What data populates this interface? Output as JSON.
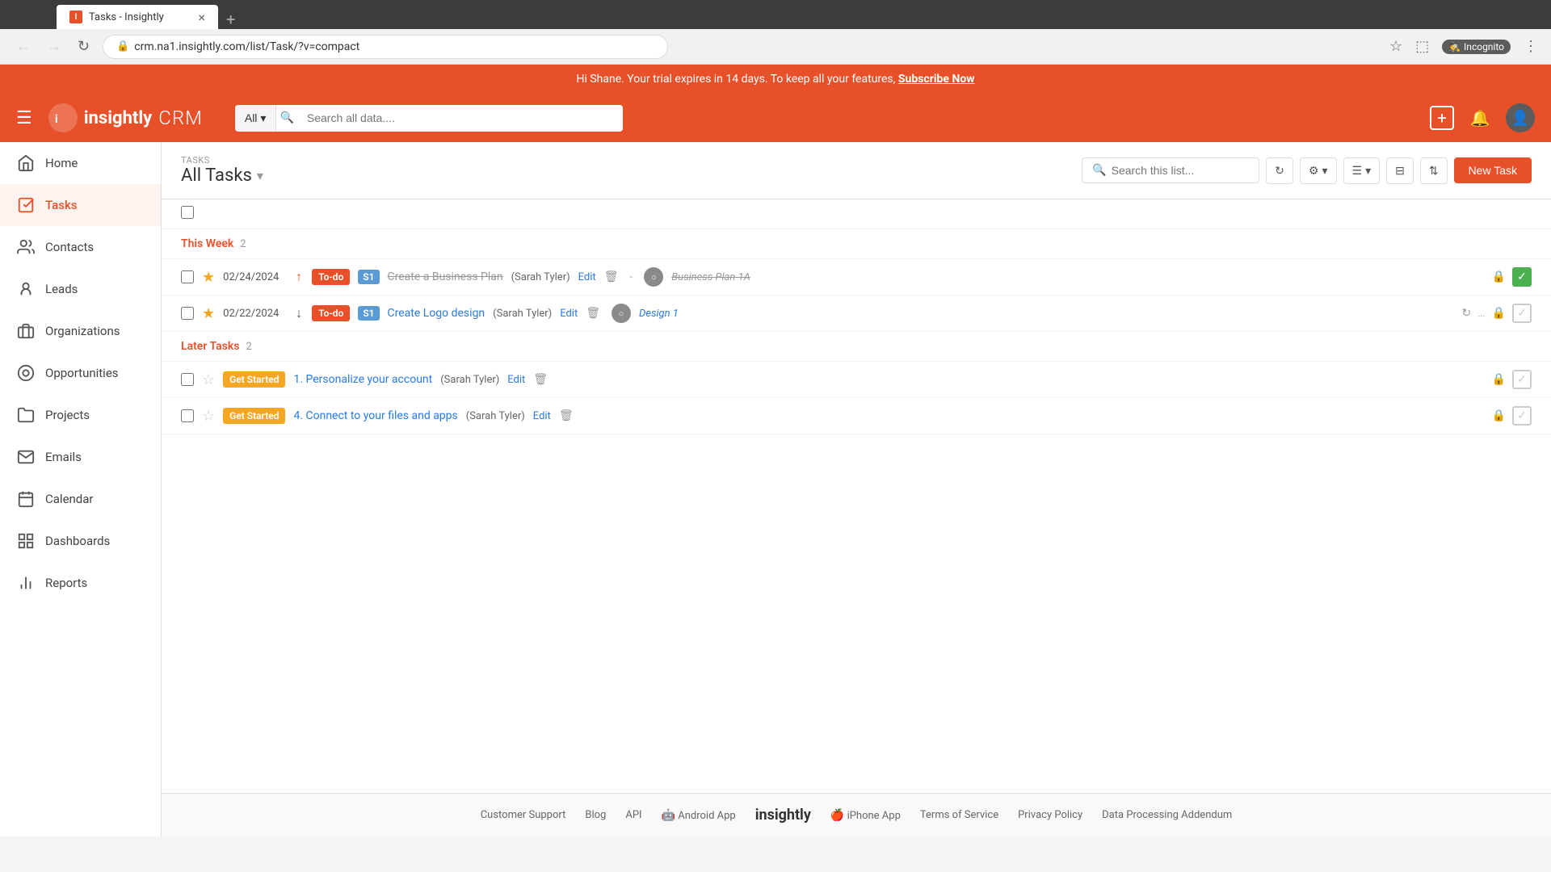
{
  "browser": {
    "tab_title": "Tasks - Insightly",
    "tab_favicon": "I",
    "address": "crm.na1.insightly.com/list/Task/?v=compact",
    "incognito_label": "Incognito",
    "new_tab_icon": "+",
    "back_icon": "←",
    "forward_icon": "→",
    "refresh_icon": "↻",
    "home_icon": "⌂"
  },
  "banner": {
    "text": "Hi Shane. Your trial expires in 14 days. To keep all your features,",
    "link_text": "Subscribe Now"
  },
  "header": {
    "menu_icon": "☰",
    "logo_text": "insightly",
    "crm_text": "CRM",
    "search_all_label": "All",
    "search_placeholder": "Search all data....",
    "add_icon": "+",
    "bell_icon": "🔔",
    "avatar_icon": "👤"
  },
  "sidebar": {
    "items": [
      {
        "id": "home",
        "label": "Home",
        "icon": "🏠"
      },
      {
        "id": "tasks",
        "label": "Tasks",
        "icon": "✓",
        "active": true
      },
      {
        "id": "contacts",
        "label": "Contacts",
        "icon": "👥"
      },
      {
        "id": "leads",
        "label": "Leads",
        "icon": "👤"
      },
      {
        "id": "organizations",
        "label": "Organizations",
        "icon": "🏢"
      },
      {
        "id": "opportunities",
        "label": "Opportunities",
        "icon": "◎"
      },
      {
        "id": "projects",
        "label": "Projects",
        "icon": "📁"
      },
      {
        "id": "emails",
        "label": "Emails",
        "icon": "✉"
      },
      {
        "id": "calendar",
        "label": "Calendar",
        "icon": "📅"
      },
      {
        "id": "dashboards",
        "label": "Dashboards",
        "icon": "📊"
      },
      {
        "id": "reports",
        "label": "Reports",
        "icon": "📈"
      }
    ]
  },
  "tasks": {
    "section_label": "TASKS",
    "title": "All Tasks",
    "search_placeholder": "Search this list...",
    "new_task_label": "New Task",
    "this_week_label": "This Week",
    "this_week_count": "2",
    "later_tasks_label": "Later Tasks",
    "later_tasks_count": "2",
    "task_rows": [
      {
        "id": "task1",
        "starred": true,
        "date": "02/24/2024",
        "priority": "↑",
        "badge": "To-do",
        "badge_type": "todo",
        "sprint": "S1",
        "name": "Create a Business Plan",
        "name_strikethrough": true,
        "assignee": "Sarah Tyler",
        "action": "Edit",
        "linked": "Business Plan 1A",
        "linked_strikethrough": true,
        "complete": true
      },
      {
        "id": "task2",
        "starred": true,
        "date": "02/22/2024",
        "priority": "↓",
        "badge": "To-do",
        "badge_type": "todo",
        "sprint": "S1",
        "name": "Create Logo design",
        "name_strikethrough": false,
        "assignee": "Sarah Tyler",
        "action": "Edit",
        "linked": "Design 1",
        "linked_strikethrough": false,
        "complete": false,
        "spinning": true
      },
      {
        "id": "task3",
        "starred": false,
        "date": "",
        "priority": "",
        "badge": "Get Started",
        "badge_type": "get-started",
        "sprint": "",
        "name": "1. Personalize your account",
        "name_strikethrough": false,
        "assignee": "Sarah Tyler",
        "action": "Edit",
        "linked": "",
        "linked_strikethrough": false,
        "complete": false
      },
      {
        "id": "task4",
        "starred": false,
        "date": "",
        "priority": "",
        "badge": "Get Started",
        "badge_type": "get-started",
        "sprint": "",
        "name": "4. Connect to your files and apps",
        "name_strikethrough": false,
        "assignee": "Sarah Tyler",
        "action": "Edit",
        "linked": "",
        "linked_strikethrough": false,
        "complete": false
      }
    ]
  },
  "footer": {
    "links": [
      {
        "id": "customer-support",
        "label": "Customer Support"
      },
      {
        "id": "blog",
        "label": "Blog"
      },
      {
        "id": "api",
        "label": "API"
      },
      {
        "id": "android-app",
        "label": "Android App",
        "icon": "android"
      },
      {
        "id": "logo",
        "label": "insightly",
        "is_logo": true
      },
      {
        "id": "iphone-app",
        "label": "iPhone App",
        "icon": "apple"
      },
      {
        "id": "terms",
        "label": "Terms of Service"
      },
      {
        "id": "privacy",
        "label": "Privacy Policy"
      },
      {
        "id": "data-processing",
        "label": "Data Processing Addendum"
      }
    ]
  }
}
